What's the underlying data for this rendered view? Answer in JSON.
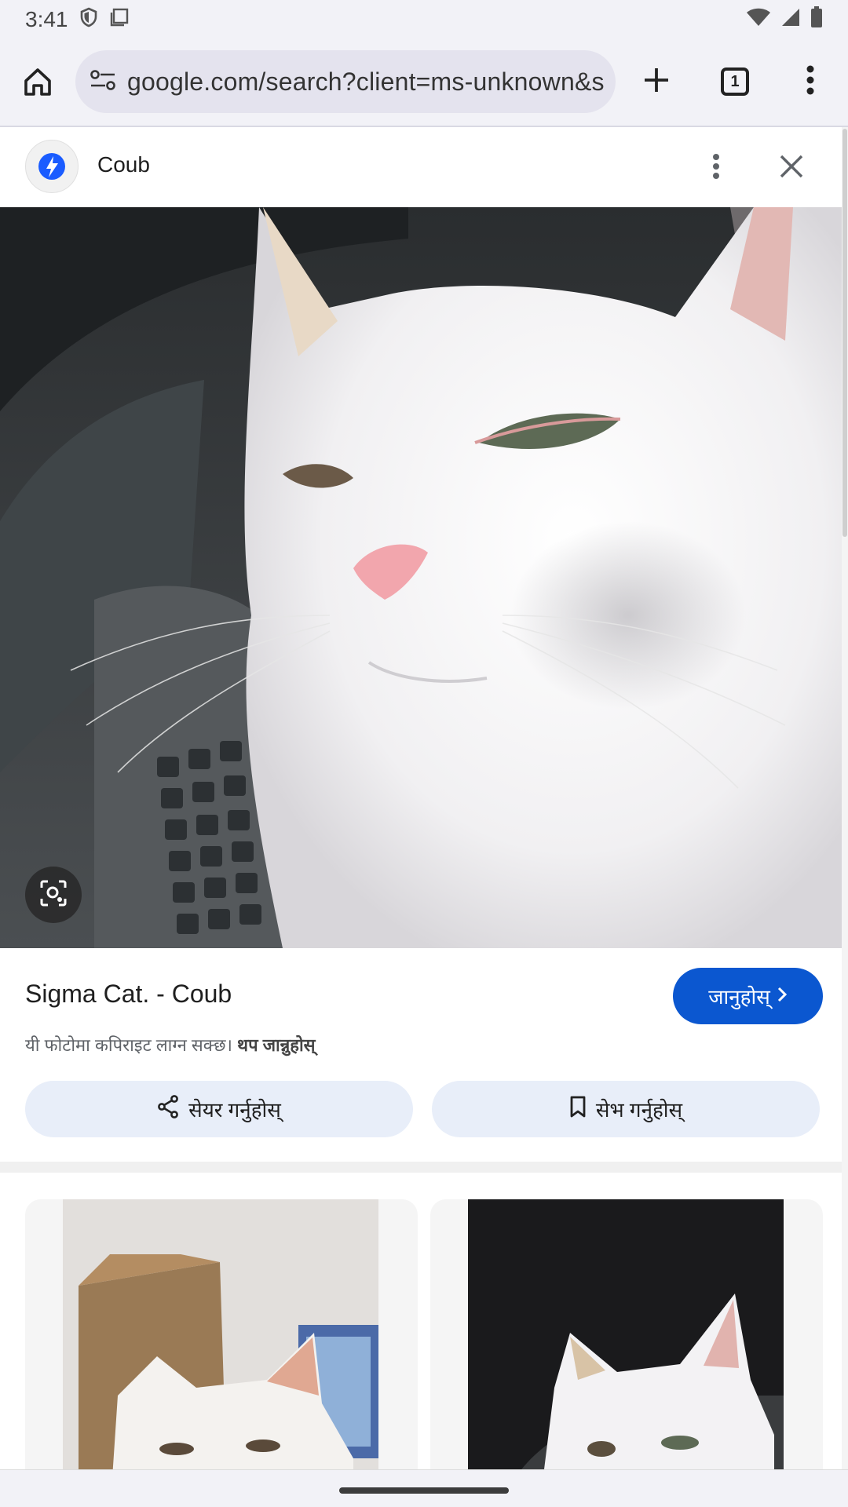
{
  "status_bar": {
    "time": "3:41"
  },
  "browser": {
    "url": "google.com/search?client=ms-unknown&s",
    "tab_count": "1"
  },
  "viewer": {
    "site_name": "Coub",
    "image_title": "Sigma Cat. - Coub",
    "visit_label": "जानुहोस्",
    "copyright_text": "यी फोटोमा कपिराइट लाग्न सक्छ।",
    "learn_more": "थप जान्नुहोस्",
    "share_label": "सेयर गर्नुहोस्",
    "save_label": "सेभ गर्नुहोस्"
  },
  "colors": {
    "accent": "#0b57d0",
    "toolbar_bg": "#f2f2f7",
    "chip_bg": "#e8eef9"
  },
  "icons": [
    "shield-icon",
    "screenshot-icon",
    "wifi-icon",
    "signal-icon",
    "battery-icon",
    "home-icon",
    "site-settings-icon",
    "plus-icon",
    "tabs-icon",
    "more-vert-icon",
    "close-icon",
    "lens-icon",
    "chevron-right-icon",
    "share-icon",
    "bookmark-icon"
  ]
}
